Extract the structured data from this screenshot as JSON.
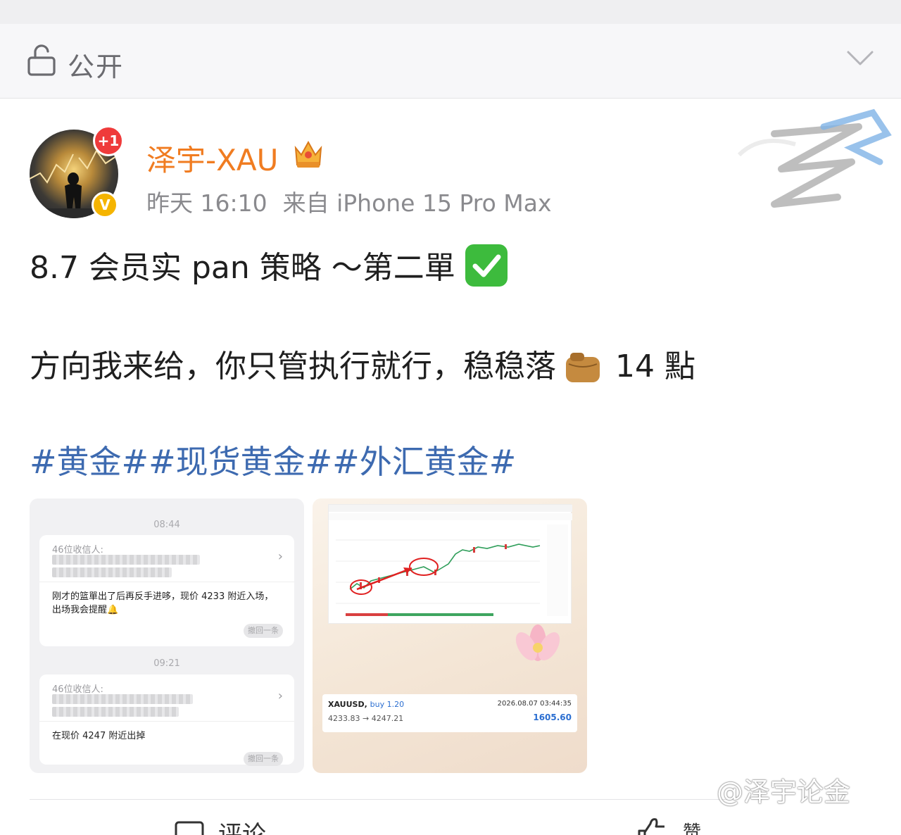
{
  "visibility": {
    "label": "公开"
  },
  "post": {
    "username": "泽宇-XAU",
    "avatar_badge": "+1",
    "verified_mark": "V",
    "time": "昨天 16:10",
    "source": "来自 iPhone 15 Pro Max",
    "line1": "8.7 会员实 pan 策略 ～第二單",
    "line2_before": "方向我来给，你只管执行就行，稳稳落",
    "line2_after": "14 點",
    "hashtags": "#黄金##现货黄金##外汇黄金#"
  },
  "image1": {
    "time1": "08:44",
    "recipients1": "46位收信人:",
    "message1": "刚才的篮單出了后再反手进哆，现价 4233 附近入场，出场我会提醒🔔",
    "withdraw1": "撤回一条",
    "time2": "09:21",
    "recipients2": "46位收信人:",
    "message2": "在现价 4247 附近出掉",
    "withdraw2": "撤回一条"
  },
  "image2": {
    "symbol": "XAUUSD,",
    "side": "buy 1.20",
    "prices": "4233.83 → 4247.21",
    "datetime": "2026.08.07 03:44:35",
    "profit": "1605.60",
    "profit_color": "#2c6fd1"
  },
  "actions": {
    "comment": "评论",
    "like": "赞"
  },
  "watermark": "@泽宇论金",
  "colors": {
    "username": "#f07c21",
    "hashtag": "#3d6ab0",
    "meta": "#8a8a8e"
  }
}
